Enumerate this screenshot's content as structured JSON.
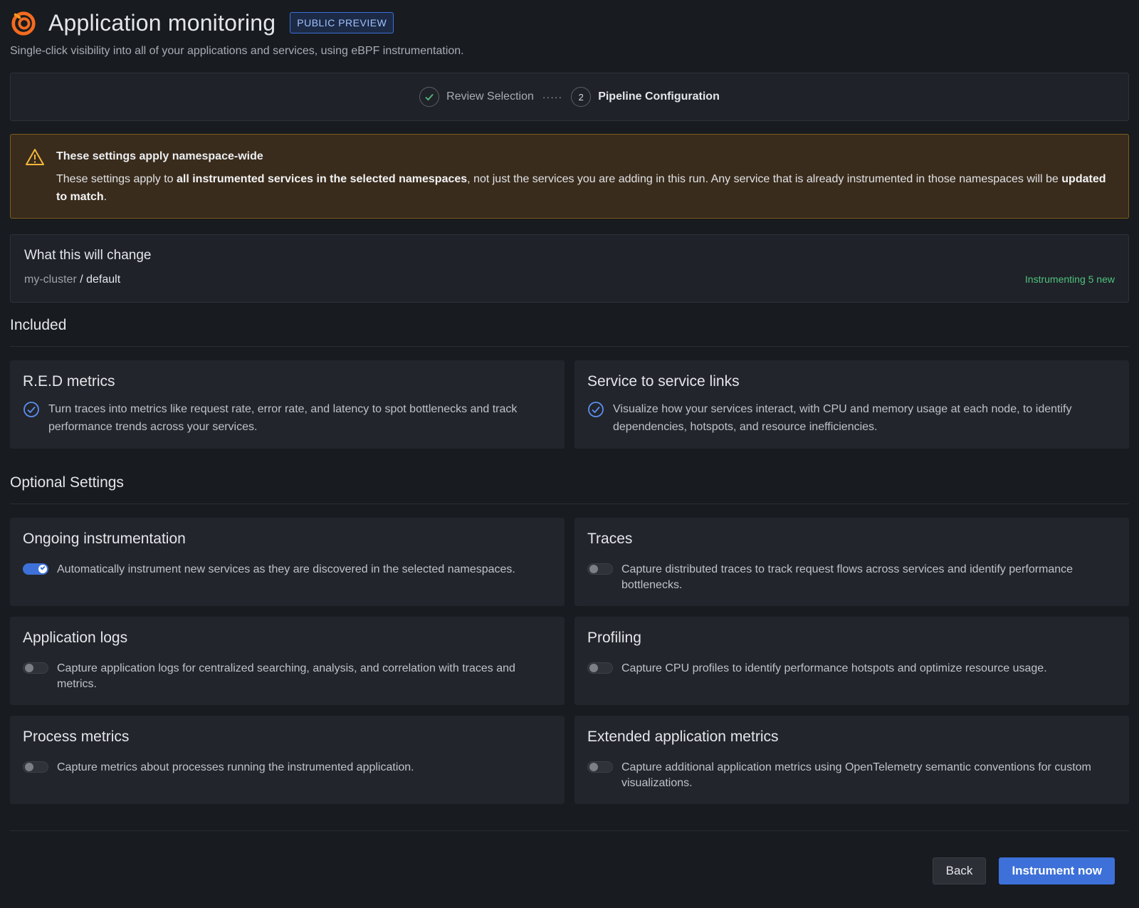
{
  "header": {
    "title": "Application monitoring",
    "badge": "PUBLIC PREVIEW",
    "subtitle": "Single-click visibility into all of your applications and services, using eBPF instrumentation."
  },
  "stepper": {
    "step1_label": "Review Selection",
    "step2_number": "2",
    "step2_label": "Pipeline Configuration",
    "dots": "·····"
  },
  "warning": {
    "title": "These settings apply namespace-wide",
    "body_part1": "These settings apply to ",
    "body_bold1": "all instrumented services in the selected namespaces",
    "body_part2": ", not just the services you are adding in this run. Any service that is already instrumented in those namespaces will be ",
    "body_bold2": "updated to match",
    "body_part3": "."
  },
  "change": {
    "title": "What this will change",
    "cluster": "my-cluster",
    "separator": " / ",
    "namespace": "default",
    "status": "Instrumenting 5 new"
  },
  "included": {
    "title": "Included",
    "cards": [
      {
        "title": "R.E.D metrics",
        "desc": "Turn traces into metrics like request rate, error rate, and latency to spot bottlenecks and track performance trends across your services."
      },
      {
        "title": "Service to service links",
        "desc": "Visualize how your services interact, with CPU and memory usage at each node, to identify dependencies, hotspots, and resource inefficiencies."
      }
    ]
  },
  "optional": {
    "title": "Optional Settings",
    "cards": [
      {
        "title": "Ongoing instrumentation",
        "desc": "Automatically instrument new services as they are discovered in the selected namespaces.",
        "enabled": true
      },
      {
        "title": "Traces",
        "desc": "Capture distributed traces to track request flows across services and identify performance bottlenecks.",
        "enabled": false
      },
      {
        "title": "Application logs",
        "desc": "Capture application logs for centralized searching, analysis, and correlation with traces and metrics.",
        "enabled": false
      },
      {
        "title": "Profiling",
        "desc": "Capture CPU profiles to identify performance hotspots and optimize resource usage.",
        "enabled": false
      },
      {
        "title": "Process metrics",
        "desc": "Capture metrics about processes running the instrumented application.",
        "enabled": false
      },
      {
        "title": "Extended application metrics",
        "desc": "Capture additional application metrics using OpenTelemetry semantic conventions for custom visualizations.",
        "enabled": false
      }
    ]
  },
  "footer": {
    "back_label": "Back",
    "primary_label": "Instrument now"
  },
  "colors": {
    "accent": "#3d71d9",
    "success": "#4fc27f",
    "warning_border": "#7a5c1e",
    "logo": "#f46b1f"
  }
}
